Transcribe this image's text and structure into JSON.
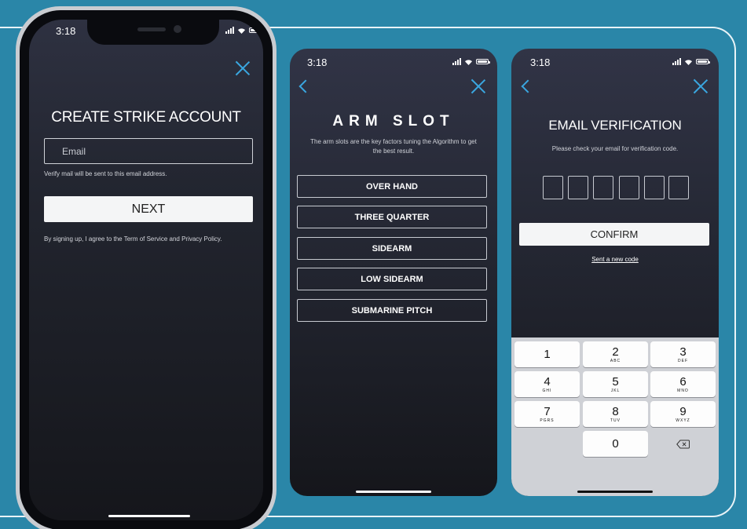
{
  "colors": {
    "background": "#2a86a8",
    "accent": "#3aa7e0",
    "screen": "#22252f"
  },
  "phone1": {
    "status_time": "3:18",
    "title": "CREATE STRIKE ACCOUNT",
    "email_placeholder": "Email",
    "email_hint": "Verify mail will be sent to this email address.",
    "next_label": "NEXT",
    "terms": "By signing up, I agree to the Term of Service and Privacy Policy."
  },
  "phone2": {
    "status_time": "3:18",
    "title": "ARM SLOT",
    "subtitle": "The arm slots are the key factors tuning the Algorithm to get the best result.",
    "options": [
      "OVER HAND",
      "THREE QUARTER",
      "SIDEARM",
      "LOW SIDEARM",
      "SUBMARINE PITCH"
    ]
  },
  "phone3": {
    "status_time": "3:18",
    "title": "EMAIL VERIFICATION",
    "subtitle": "Please check your email for verification code.",
    "code_digits": [
      "",
      "",
      "",
      "",
      "",
      ""
    ],
    "confirm_label": "CONFIRM",
    "resend_label": "Sent a new code",
    "keypad": [
      {
        "num": "1",
        "letters": ""
      },
      {
        "num": "2",
        "letters": "ABC"
      },
      {
        "num": "3",
        "letters": "DEF"
      },
      {
        "num": "4",
        "letters": "GHI"
      },
      {
        "num": "5",
        "letters": "JKL"
      },
      {
        "num": "6",
        "letters": "MNO"
      },
      {
        "num": "7",
        "letters": "PGRS"
      },
      {
        "num": "8",
        "letters": "TUV"
      },
      {
        "num": "9",
        "letters": "WXYZ"
      },
      {
        "num": "0",
        "letters": ""
      }
    ]
  }
}
